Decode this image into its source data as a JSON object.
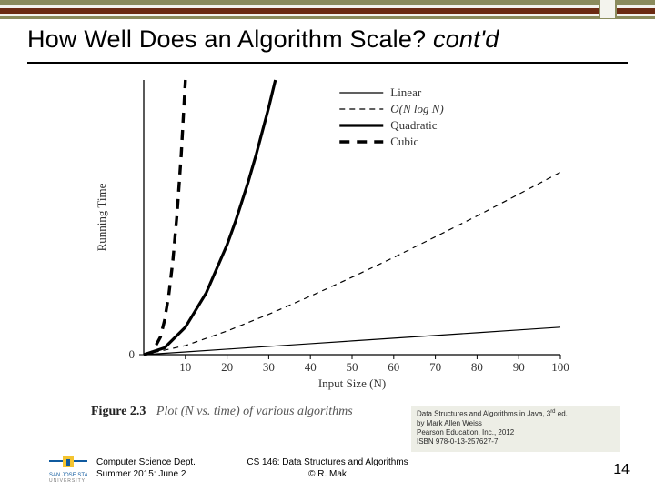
{
  "title": {
    "main": "How Well Does an Algorithm Scale?",
    "contd": "cont'd"
  },
  "chart_data": {
    "type": "line",
    "xlabel": "Input Size (N)",
    "ylabel": "Running Time",
    "xlim": [
      0,
      100
    ],
    "ylim": [
      0,
      1000
    ],
    "xticks": [
      10,
      20,
      30,
      40,
      50,
      60,
      70,
      80,
      90,
      100
    ],
    "yticks": [
      0
    ],
    "legend_position": "top-right",
    "series": [
      {
        "name": "Linear",
        "style": "solid-thin",
        "x": [
          0,
          10,
          20,
          30,
          40,
          50,
          60,
          70,
          80,
          90,
          100
        ],
        "y": [
          0,
          10,
          20,
          30,
          40,
          50,
          60,
          70,
          80,
          90,
          100
        ]
      },
      {
        "name": "O(N log N)",
        "style": "dashed-thin",
        "x": [
          0,
          10,
          20,
          30,
          40,
          50,
          60,
          70,
          80,
          90,
          100
        ],
        "y": [
          0,
          33,
          86,
          147,
          213,
          282,
          354,
          429,
          505,
          584,
          664
        ]
      },
      {
        "name": "Quadratic",
        "style": "solid-thick",
        "x": [
          0,
          5,
          10,
          15,
          20,
          22,
          25,
          27,
          30,
          31.6
        ],
        "y": [
          0,
          25,
          100,
          225,
          400,
          484,
          625,
          729,
          900,
          1000
        ]
      },
      {
        "name": "Cubic",
        "style": "dashed-thick",
        "x": [
          0,
          2,
          4,
          5,
          6,
          7,
          8,
          9,
          10
        ],
        "y": [
          0,
          8,
          64,
          125,
          216,
          343,
          512,
          729,
          1000
        ]
      }
    ]
  },
  "caption": {
    "label": "Figure 2.3",
    "text": "Plot (N vs. time) of various algorithms"
  },
  "source": {
    "line1_a": "Data Structures and Algorithms in Java, 3",
    "line1_sup": "rd",
    "line1_b": " ed.",
    "line2": "by Mark Allen Weiss",
    "line3": "Pearson Education, Inc., 2012",
    "line4": "ISBN 978-0-13-257627-7"
  },
  "footer": {
    "left1": "Computer Science Dept.",
    "left2": "Summer 2015: June 2",
    "center1": "CS 146: Data Structures and Algorithms",
    "center2": "© R. Mak"
  },
  "slide_number": "14",
  "icons": {
    "logo": "sjsu-logo"
  }
}
